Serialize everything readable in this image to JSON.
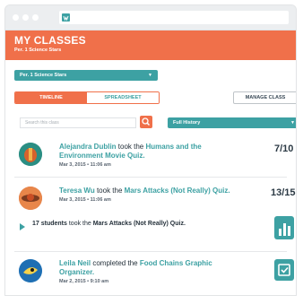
{
  "header": {
    "title": "MY CLASSES",
    "subtitle": "Per. 1 Science Stars"
  },
  "class_selector": {
    "selected": "Per. 1 Science Stars"
  },
  "tabs": [
    {
      "label": "TIMELINE",
      "active": true
    },
    {
      "label": "SPREADSHEET",
      "active": false
    }
  ],
  "manage_button": "MANAGE CLASS",
  "search": {
    "placeholder": "Search this class"
  },
  "history_filter": {
    "selected": "Full History"
  },
  "activity": [
    {
      "name": "Alejandra Dublin",
      "verb": " took the ",
      "item": "Humans and the Environment Movie Quiz.",
      "time": "Mar 3, 2015  •  11:06 am",
      "score": "7/10"
    },
    {
      "name": "Teresa Wu",
      "verb": " took the ",
      "item": "Mars Attacks (Not Really) Quiz.",
      "time": "Mar 3, 2015  •  11:06 am",
      "score": "13/15"
    }
  ],
  "summary": {
    "count": "17 students",
    "verb": " took the ",
    "item": "Mars Attacks (Not Really) Quiz."
  },
  "completion": {
    "name": "Leila Neil",
    "verb": " completed the ",
    "item_line1": "Food Chains Graphic",
    "item_line2": "Organizer.",
    "time": "Mar 2, 2015  •  9:10 am"
  },
  "colors": {
    "accent": "#f0704a",
    "teal": "#3da1a3"
  }
}
